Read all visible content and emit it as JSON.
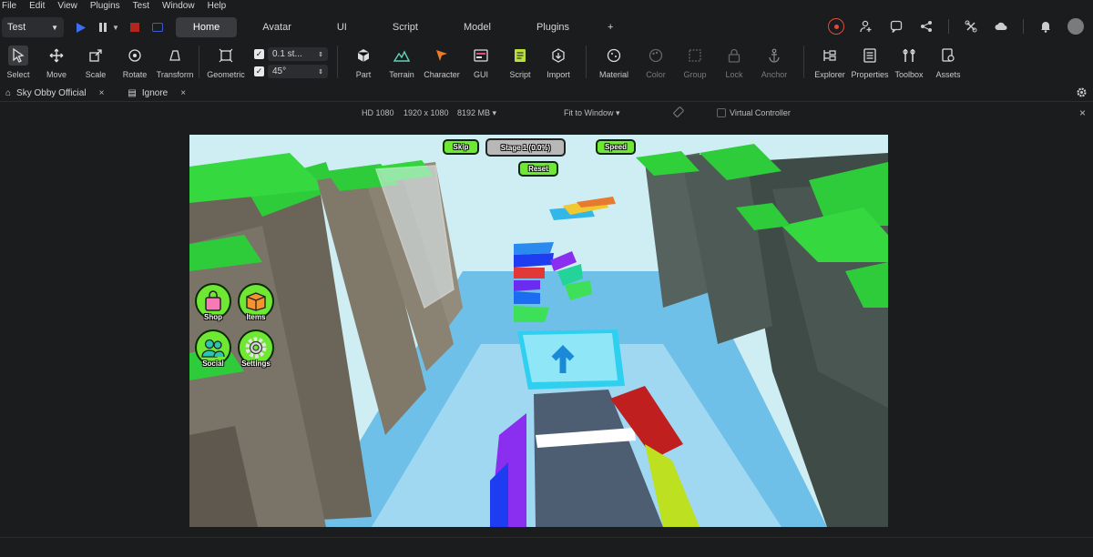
{
  "menu": [
    "File",
    "Edit",
    "View",
    "Plugins",
    "Test",
    "Window",
    "Help"
  ],
  "topbar": {
    "mode": "Test",
    "tabs": [
      "Home",
      "Avatar",
      "UI",
      "Script",
      "Model",
      "Plugins"
    ],
    "active_tab": "Home",
    "add_tab": "+"
  },
  "ribbon": {
    "tools": [
      {
        "label": "Select",
        "icon": "cursor-icon"
      },
      {
        "label": "Move",
        "icon": "move-icon"
      },
      {
        "label": "Scale",
        "icon": "scale-icon"
      },
      {
        "label": "Rotate",
        "icon": "rotate-icon"
      },
      {
        "label": "Transform",
        "icon": "transform-icon"
      }
    ],
    "geometric": "Geometric",
    "snap_move": "0.1 st...",
    "snap_rotate": "45°",
    "insert": [
      {
        "label": "Part",
        "icon": "part-icon"
      },
      {
        "label": "Terrain",
        "icon": "terrain-icon"
      },
      {
        "label": "Character",
        "icon": "character-icon"
      },
      {
        "label": "GUI",
        "icon": "gui-icon"
      },
      {
        "label": "Script",
        "icon": "script-icon"
      },
      {
        "label": "Import",
        "icon": "import-icon"
      }
    ],
    "edit": [
      {
        "label": "Material",
        "icon": "material-icon"
      },
      {
        "label": "Color",
        "icon": "color-icon"
      },
      {
        "label": "Group",
        "icon": "group-icon"
      },
      {
        "label": "Lock",
        "icon": "lock-icon"
      },
      {
        "label": "Anchor",
        "icon": "anchor-icon"
      }
    ],
    "panels": [
      {
        "label": "Explorer",
        "icon": "explorer-icon"
      },
      {
        "label": "Properties",
        "icon": "properties-icon"
      },
      {
        "label": "Toolbox",
        "icon": "toolbox-icon"
      },
      {
        "label": "Assets",
        "icon": "assets-icon"
      }
    ]
  },
  "doc_tabs": [
    {
      "label": "Sky Obby Official",
      "close": "×"
    },
    {
      "label": "Ignore",
      "close": "×"
    }
  ],
  "viewport_bar": {
    "resolution": "HD 1080",
    "size": "1920 x 1080",
    "memory": "8192 MB",
    "fit": "Fit to Window",
    "virtual_controller": "Virtual Controller",
    "close": "×"
  },
  "hud": {
    "skip": "Skip",
    "stage": "Stage 1 (0.0%)",
    "speed": "Speed",
    "reset": "Reset",
    "shop": "Shop",
    "items": "Items",
    "social": "Social",
    "settings": "Settings"
  },
  "colors": {
    "accent_blue": "#3b5bd6",
    "stop_red": "#b3261e",
    "hud_green": "#6ee832",
    "record_red": "#e24b3b"
  }
}
